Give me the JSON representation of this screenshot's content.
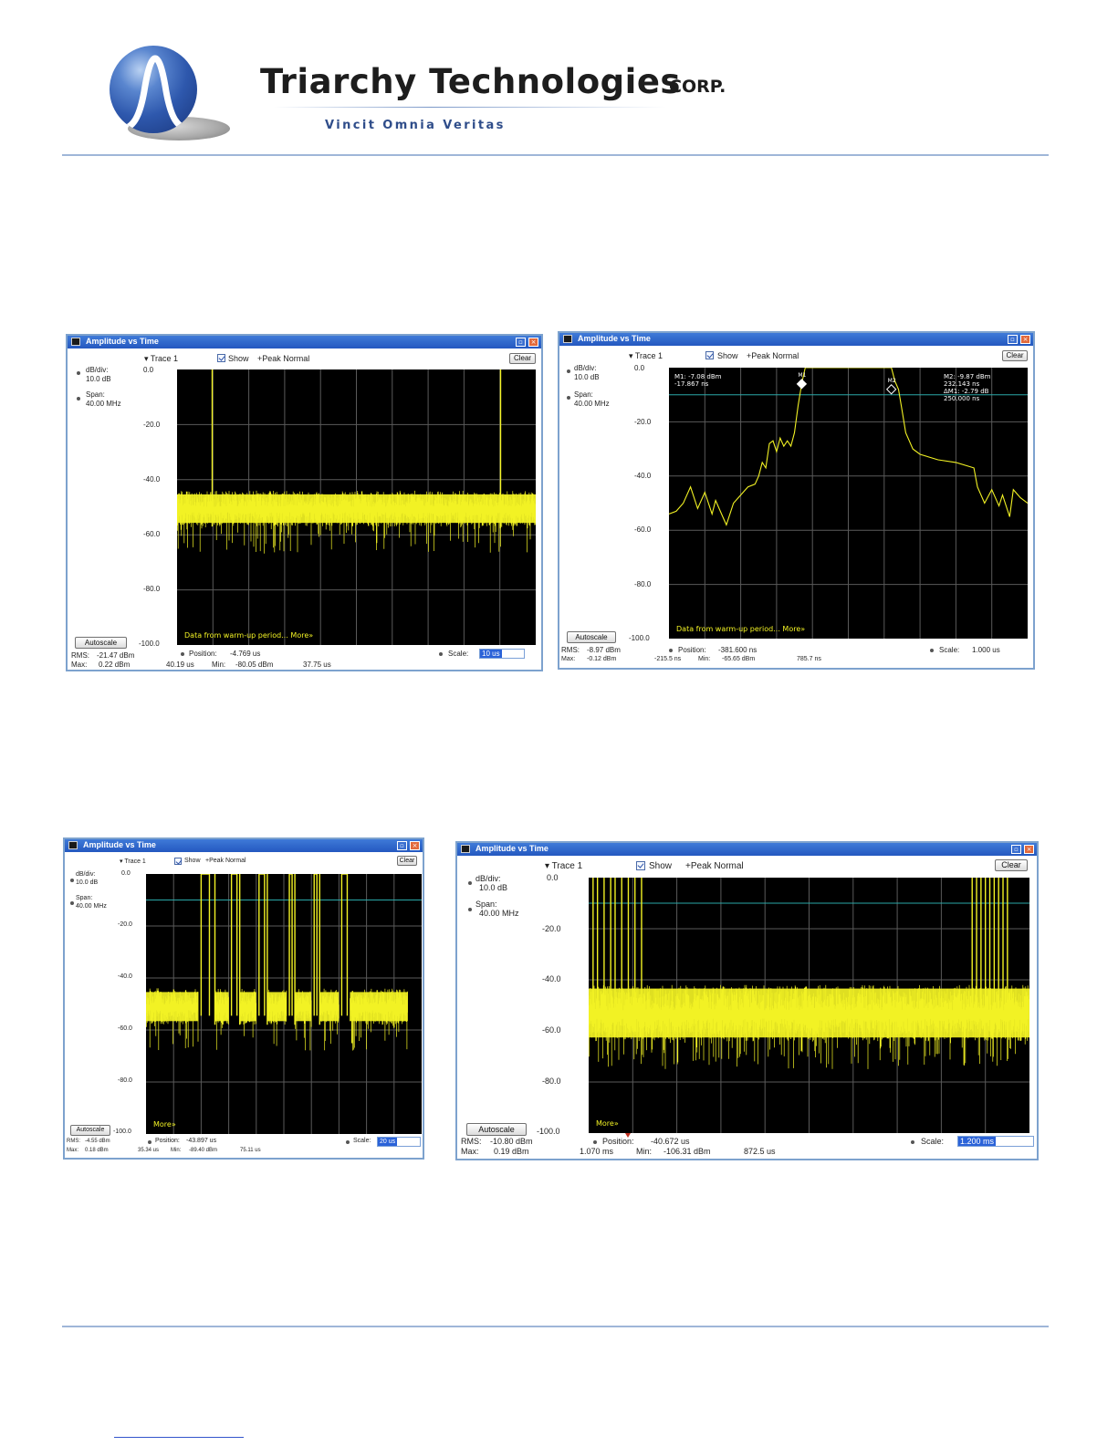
{
  "header": {
    "brand": "Triarchy Technologies",
    "corp": "CORP.",
    "tagline": "Vincit Omnia Veritas"
  },
  "screens": [
    {
      "title": "Amplitude vs Time",
      "trace": "Trace 1",
      "show": "Show",
      "mode": "+Peak Normal",
      "clear": "Clear",
      "dbdiv_label": "dB/div:",
      "dbdiv_value": "10.0 dB",
      "span_label": "Span:",
      "span_value": "40.00 MHz",
      "autoscale": "Autoscale",
      "message": "Data from warm-up period... More»",
      "position_label": "Position:",
      "position_value": "-4.769 us",
      "scale_label": "Scale:",
      "scale_value": "10 us",
      "rms_label": "RMS:",
      "rms_value": "-21.47 dBm",
      "max_label": "Max:",
      "max_value": "0.22 dBm",
      "max_at": "40.19 us",
      "min_label": "Min:",
      "min_value": "-80.05 dBm",
      "min_at": "37.75 us",
      "markers": [],
      "chart_data": {
        "type": "line",
        "title": "",
        "yticks": [
          "0.0",
          "-20.0",
          "-40.0",
          "-60.0",
          "-80.0",
          "-100.0"
        ],
        "ylim": [
          -100,
          0
        ],
        "xlim": [
          0,
          100
        ],
        "grid": true,
        "noise_band": [
          -57,
          -44
        ],
        "noise_floor": -67,
        "threshold": null,
        "bursts": [],
        "spikes": [
          {
            "x": 9.8,
            "y": 0
          },
          {
            "x": 90.2,
            "y": 0
          }
        ]
      }
    },
    {
      "title": "Amplitude vs Time",
      "trace": "Trace 1",
      "show": "Show",
      "mode": "+Peak Normal",
      "clear": "Clear",
      "dbdiv_label": "dB/div:",
      "dbdiv_value": "10.0 dB",
      "span_label": "Span:",
      "span_value": "40.00 MHz",
      "autoscale": "Autoscale",
      "message": "Data from warm-up period... More»",
      "position_label": "Position:",
      "position_value": "-381.600 ns",
      "scale_label": "Scale:",
      "scale_value": "1.000 us",
      "rms_label": "RMS:",
      "rms_value": "-8.97 dBm",
      "max_label": "Max:",
      "max_value": "-0.12 dBm",
      "max_at": "-215.5 ns",
      "min_label": "Min:",
      "min_value": "-65.65 dBm",
      "min_at": "785.7 ns",
      "markers": [
        {
          "label": "M1",
          "readout": [
            "M1: -7.08 dBm",
            "-17.867 ns"
          ],
          "x": 37.0,
          "y": -6
        },
        {
          "label": "M2",
          "readout": [
            "M2: -9.87 dBm",
            "232.143 ns",
            "ΔM1: -2.79 dB",
            "250.000 ns"
          ],
          "x": 62.0,
          "y": -8
        }
      ],
      "chart_data": {
        "type": "line",
        "title": "",
        "yticks": [
          "0.0",
          "-20.0",
          "-40.0",
          "-60.0",
          "-80.0",
          "-100.0"
        ],
        "ylim": [
          -100,
          0
        ],
        "xlim": [
          0,
          100
        ],
        "grid": true,
        "threshold": -10,
        "series": [
          {
            "x": [
              0,
              2,
              4,
              6,
              8,
              10,
              12,
              13,
              15,
              16,
              18,
              20,
              22,
              24,
              25,
              26,
              27,
              28,
              29,
              30,
              31,
              32,
              33,
              34,
              35,
              36,
              37,
              38,
              40,
              45,
              50,
              55,
              58,
              60,
              62,
              63,
              64,
              65,
              66,
              67,
              68,
              70,
              75,
              80,
              85,
              86,
              88,
              90,
              92,
              93,
              95,
              96,
              98,
              100
            ],
            "y": [
              -54,
              -53,
              -50,
              -44,
              -52,
              -46,
              -54,
              -49,
              -55,
              -58,
              -50,
              -47,
              -44,
              -43,
              -40,
              -35,
              -37,
              -28,
              -27,
              -31,
              -26,
              -29,
              -27,
              -29,
              -24,
              -14,
              -6,
              0,
              0,
              0,
              0,
              0,
              0,
              0,
              0,
              -5,
              -8,
              -16,
              -24,
              -27,
              -30,
              -32,
              -34,
              -35,
              -37,
              -44,
              -50,
              -45,
              -51,
              -47,
              -55,
              -45,
              -48,
              -50
            ]
          }
        ]
      }
    },
    {
      "title": "Amplitude vs Time",
      "trace": "Trace 1",
      "show": "Show",
      "mode": "+Peak Normal",
      "clear": "Clear",
      "dbdiv_label": "dB/div:",
      "dbdiv_value": "10.0 dB",
      "span_label": "Span:",
      "span_value": "40.00 MHz",
      "autoscale": "Autoscale",
      "message": "More»",
      "position_label": "Position:",
      "position_value": "-43.897 us",
      "scale_label": "Scale:",
      "scale_value": "20 us",
      "rms_label": "RMS:",
      "rms_value": "-4.55 dBm",
      "max_label": "Max:",
      "max_value": "0.18 dBm",
      "max_at": "35.34 us",
      "min_label": "Min:",
      "min_value": "-89.40 dBm",
      "min_at": "75.11 us",
      "markers": [],
      "chart_data": {
        "type": "line",
        "title": "",
        "yticks": [
          "0.0",
          "-20.0",
          "-40.0",
          "-60.0",
          "-80.0",
          "-100.0"
        ],
        "ylim": [
          -100,
          0
        ],
        "xlim": [
          0,
          100
        ],
        "grid": true,
        "threshold": -10,
        "noise_floor": -68,
        "noise_band": [
          -58,
          -44
        ],
        "segments": [
          [
            0,
            19
          ],
          [
            25,
            30
          ],
          [
            34,
            40
          ],
          [
            44,
            51
          ],
          [
            54,
            60
          ],
          [
            63,
            70
          ],
          [
            74,
            95
          ]
        ],
        "bursts": [
          {
            "from": 20,
            "to": 23
          },
          {
            "from": 31,
            "to": 33
          },
          {
            "from": 41,
            "to": 43
          },
          {
            "from": 52,
            "to": 53
          },
          {
            "from": 61,
            "to": 62
          },
          {
            "from": 71,
            "to": 73
          }
        ],
        "spikes": [
          {
            "x": 25,
            "y": 0
          },
          {
            "x": 34,
            "y": 0
          },
          {
            "x": 44,
            "y": 0
          },
          {
            "x": 54,
            "y": 0
          },
          {
            "x": 63,
            "y": 0
          }
        ]
      }
    },
    {
      "title": "Amplitude vs Time",
      "trace": "Trace 1",
      "show": "Show",
      "mode": "+Peak Normal",
      "clear": "Clear",
      "dbdiv_label": "dB/div:",
      "dbdiv_value": "10.0 dB",
      "span_label": "Span:",
      "span_value": "40.00 MHz",
      "autoscale": "Autoscale",
      "message": "More»",
      "position_label": "Position:",
      "position_value": "-40.672 us",
      "scale_label": "Scale:",
      "scale_value": "1.200 ms",
      "rms_label": "RMS:",
      "rms_value": "-10.80 dBm",
      "max_label": "Max:",
      "max_value": "0.19 dBm",
      "max_at": "1.070 ms",
      "min_label": "Min:",
      "min_value": "-106.31 dBm",
      "min_at": "872.5 us",
      "markers": [],
      "chart_data": {
        "type": "line",
        "title": "",
        "yticks": [
          "0.0",
          "-20.0",
          "-40.0",
          "-60.0",
          "-80.0",
          "-100.0"
        ],
        "ylim": [
          -100,
          0
        ],
        "xlim": [
          0,
          100
        ],
        "grid": true,
        "threshold": -10,
        "noise_floor": -75,
        "noise_band": [
          -64,
          -42
        ],
        "segments": [
          [
            0,
            100
          ]
        ],
        "bursts": [
          {
            "from": 1,
            "to": 12,
            "lines": [
              1,
              2,
              3.5,
              5,
              6,
              7.5,
              9,
              10.5,
              12
            ]
          },
          {
            "from": 87,
            "to": 95,
            "lines": [
              87,
              88,
              89,
              90,
              91,
              92,
              93,
              94,
              95
            ]
          }
        ],
        "spikes": []
      }
    }
  ]
}
